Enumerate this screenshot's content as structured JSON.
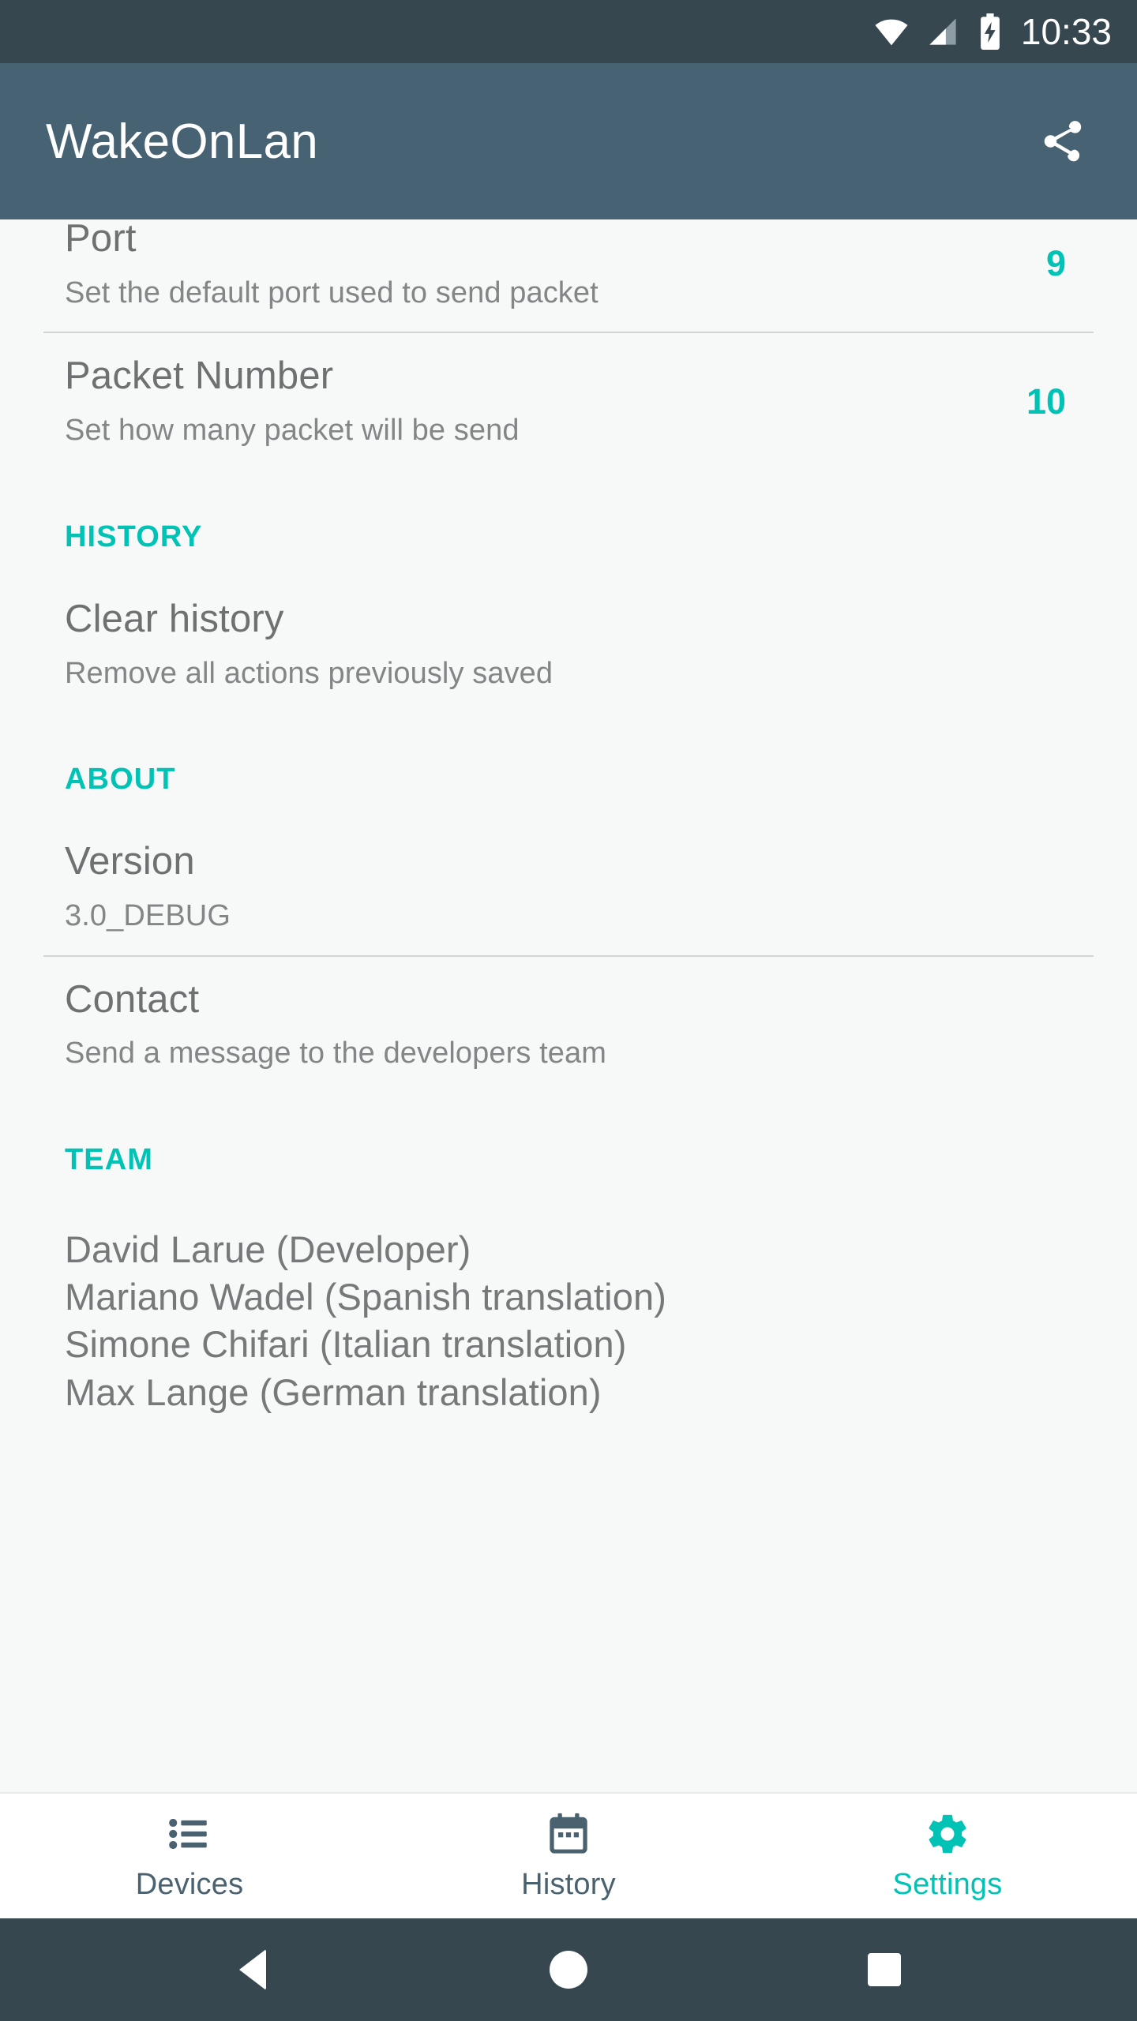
{
  "status_bar": {
    "time": "10:33",
    "icons": [
      "wifi-icon",
      "cellular-signal-icon",
      "battery-charging-icon"
    ]
  },
  "app_bar": {
    "title": "WakeOnLan",
    "share_icon": "share-icon"
  },
  "settings": {
    "rows": [
      {
        "title": "Port",
        "summary": "Set the default port used to send packet",
        "value": "9"
      },
      {
        "title": "Packet Number",
        "summary": "Set how many packet will be send",
        "value": "10"
      }
    ],
    "history_section": {
      "header": "HISTORY",
      "row": {
        "title": "Clear history",
        "summary": "Remove all actions previously saved"
      }
    },
    "about_section": {
      "header": "ABOUT",
      "version_row": {
        "title": "Version",
        "summary": "3.0_DEBUG"
      },
      "contact_row": {
        "title": "Contact",
        "summary": "Send a message to the developers team"
      }
    },
    "team_section": {
      "header": "TEAM",
      "members": [
        "David Larue (Developer)",
        "Mariano Wadel (Spanish translation)",
        "Simone Chifari (Italian translation)",
        "Max Lange (German translation)"
      ]
    }
  },
  "bottom_nav": {
    "tabs": [
      {
        "label": "Devices",
        "icon": "list-icon",
        "active": false
      },
      {
        "label": "History",
        "icon": "calendar-icon",
        "active": false
      },
      {
        "label": "Settings",
        "icon": "gear-icon",
        "active": true
      }
    ]
  },
  "android_nav": {
    "back": "back-triangle-icon",
    "home": "home-circle-icon",
    "recents": "recents-square-icon"
  },
  "colors": {
    "status_bar": "#37474f",
    "app_bar": "#476273",
    "accent": "#00c3b6",
    "background": "#f7f8f8",
    "title_text": "#6e7071",
    "summary_text": "#838587",
    "inactive_tab": "#4a626f"
  }
}
